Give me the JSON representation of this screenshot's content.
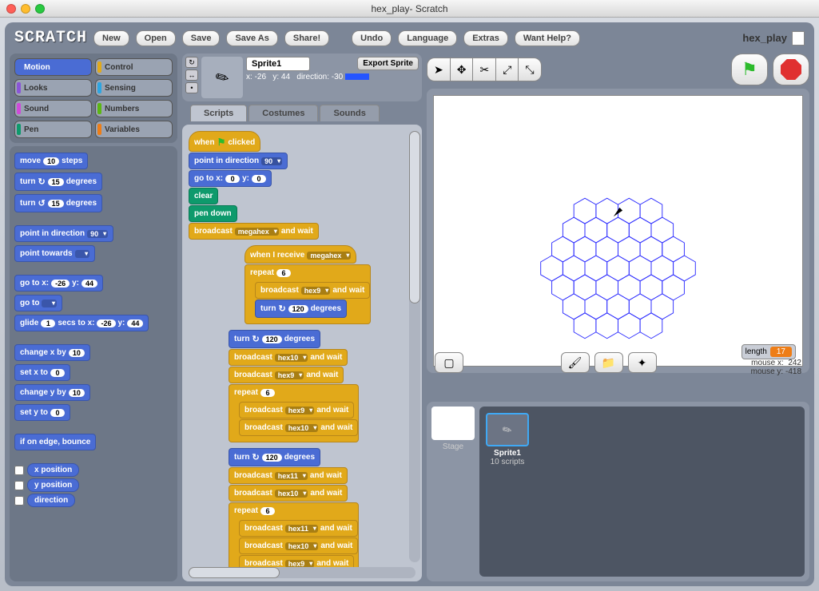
{
  "window": {
    "title": "hex_play- Scratch"
  },
  "logo": "SCRATCH",
  "project": "hex_play",
  "toolbar": {
    "new": "New",
    "open": "Open",
    "save": "Save",
    "saveas": "Save As",
    "share": "Share!",
    "undo": "Undo",
    "language": "Language",
    "extras": "Extras",
    "help": "Want Help?"
  },
  "categories": {
    "motion": "Motion",
    "control": "Control",
    "looks": "Looks",
    "sensing": "Sensing",
    "sound": "Sound",
    "numbers": "Numbers",
    "pen": "Pen",
    "variables": "Variables"
  },
  "palette": {
    "move": "move",
    "move_v": "10",
    "steps": "steps",
    "turn": "turn",
    "turn_r_v": "15",
    "turn_l_v": "15",
    "degrees": "degrees",
    "point_dir": "point in direction",
    "point_dir_v": "90",
    "point_towards": "point towards",
    "goto_xy": "go to x:",
    "goto_x": "-26",
    "goto_yl": "y:",
    "goto_y": "44",
    "goto": "go to",
    "glide": "glide",
    "glide_s": "1",
    "secs_to_x": "secs to x:",
    "glide_x": "-26",
    "glide_y": "44",
    "change_x": "change x by",
    "change_x_v": "10",
    "set_x": "set x to",
    "set_x_v": "0",
    "change_y": "change y by",
    "change_y_v": "10",
    "set_y": "set y to",
    "set_y_v": "0",
    "bounce": "if on edge, bounce",
    "xpos": "x position",
    "ypos": "y position",
    "dir": "direction"
  },
  "sprite": {
    "name": "Sprite1",
    "export": "Export Sprite",
    "xlabel": "x:",
    "x": "-26",
    "ylabel": "y:",
    "y": "44",
    "dirlabel": "direction:",
    "dir": "-30",
    "scripts_count": "10 scripts"
  },
  "tabs": {
    "scripts": "Scripts",
    "costumes": "Costumes",
    "sounds": "Sounds"
  },
  "scripts": {
    "when_clicked_a": "when",
    "when_clicked_b": "clicked",
    "point_dir": "point in direction",
    "point_dir_v": "90",
    "goto_x": "go to x:",
    "gx": "0",
    "gyl": "y:",
    "gy": "0",
    "clear": "clear",
    "pendown": "pen down",
    "broadcast": "broadcast",
    "bc_megahex": "megahex",
    "and_wait": "and wait",
    "when_receive": "when I receive",
    "repeat": "repeat",
    "rep6": "6",
    "bc_hex9": "hex9",
    "bc_hex10": "hex10",
    "bc_hex11": "hex11",
    "turn": "turn",
    "t120": "120",
    "deg": "degrees"
  },
  "stage": {
    "monitor_label": "length",
    "monitor_val": "17",
    "mouse_xl": "mouse x:",
    "mouse_x": "242",
    "mouse_yl": "mouse y:",
    "mouse_y": "-418",
    "stage_label": "Stage"
  },
  "stage_tools": {
    "pointer": "pointer",
    "stamp": "stamp",
    "scissors": "cut",
    "grow": "grow",
    "shrink": "shrink",
    "presentation": "presentation",
    "paint": "paint-new",
    "import": "import",
    "surprise": "surprise"
  }
}
